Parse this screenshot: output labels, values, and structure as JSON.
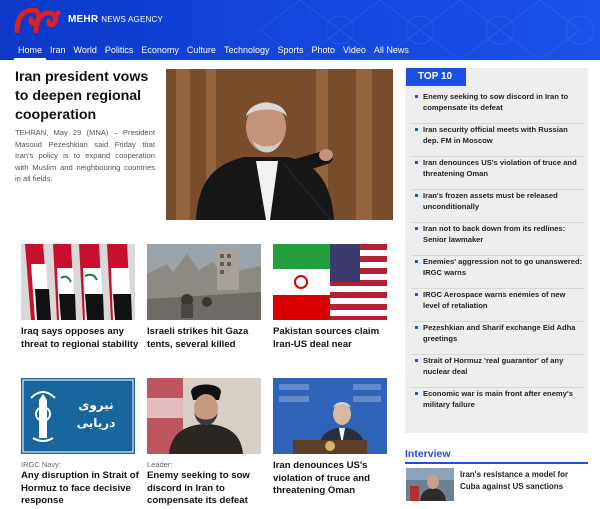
{
  "header": {
    "brand": "MEHR",
    "brand_suffix": "NEWS AGENCY",
    "nav": [
      "Home",
      "Iran",
      "World",
      "Politics",
      "Economy",
      "Culture",
      "Technology",
      "Sports",
      "Photo",
      "Video",
      "All News"
    ],
    "colors": {
      "header": "#1345dd",
      "accent": "#1c4fe3",
      "logo_red": "#e0201f"
    }
  },
  "lead": {
    "title": "Iran president vows to deepen regional cooperation",
    "summary": "TEHRAN, May 29 (MNA) – President Masoud Pezeshkian said Friday that Iran's policy is to expand cooperation with Muslim and neighbouring countries in all fields.",
    "image_icon": "president-speaking-photo"
  },
  "cards": [
    {
      "kicker": "",
      "title": "Iraq says opposes any threat to regional stability",
      "image_icon": "iraqi-flags-photo"
    },
    {
      "kicker": "",
      "title": "Israeli strikes hit Gaza tents, several killed",
      "image_icon": "gaza-ruins-photo"
    },
    {
      "kicker": "",
      "title": "Pakistan sources claim Iran-US deal near",
      "image_icon": "iran-us-flags-photo"
    },
    {
      "kicker": "IRGC Navy:",
      "title": "Any disruption in Strait of Hormuz to face decisive response",
      "image_icon": "irgc-navy-emblem"
    },
    {
      "kicker": "Leader:",
      "title": "Enemy seeking to sow discord in Iran to compensate its defeat",
      "image_icon": "leader-portrait-photo"
    },
    {
      "kicker": "",
      "title": "Iran denounces US's violation of truce and threatening Oman",
      "image_icon": "foreign-ministry-spokesman-photo"
    }
  ],
  "emblem_text": "نیروی دریایی",
  "top10": {
    "label": "TOP 10",
    "items": [
      "Enemy seeking to sow discord in Iran to compensate its defeat",
      "Iran security official meets with Russian dep. FM in Moscow",
      "Iran denounces US's violation of truce and threatening Oman",
      "Iran's frozen assets must be released unconditionally",
      "Iran not to back down from its redlines: Senior lawmaker",
      "Enemies' aggression not to go unanswered: IRGC warns",
      "IRGC Aerospace warns enemies of new level of retaliation",
      "Pezeshkian and Sharif exchange Eid Adha greetings",
      "Strait of Hormuz 'real guarantor' of any nuclear deal",
      "Economic war is main front after enemy's military failure"
    ]
  },
  "interview": {
    "label": "Interview",
    "title": "Iran's resistance a model for Cuba against US sanctions",
    "image_icon": "interview-photo"
  }
}
